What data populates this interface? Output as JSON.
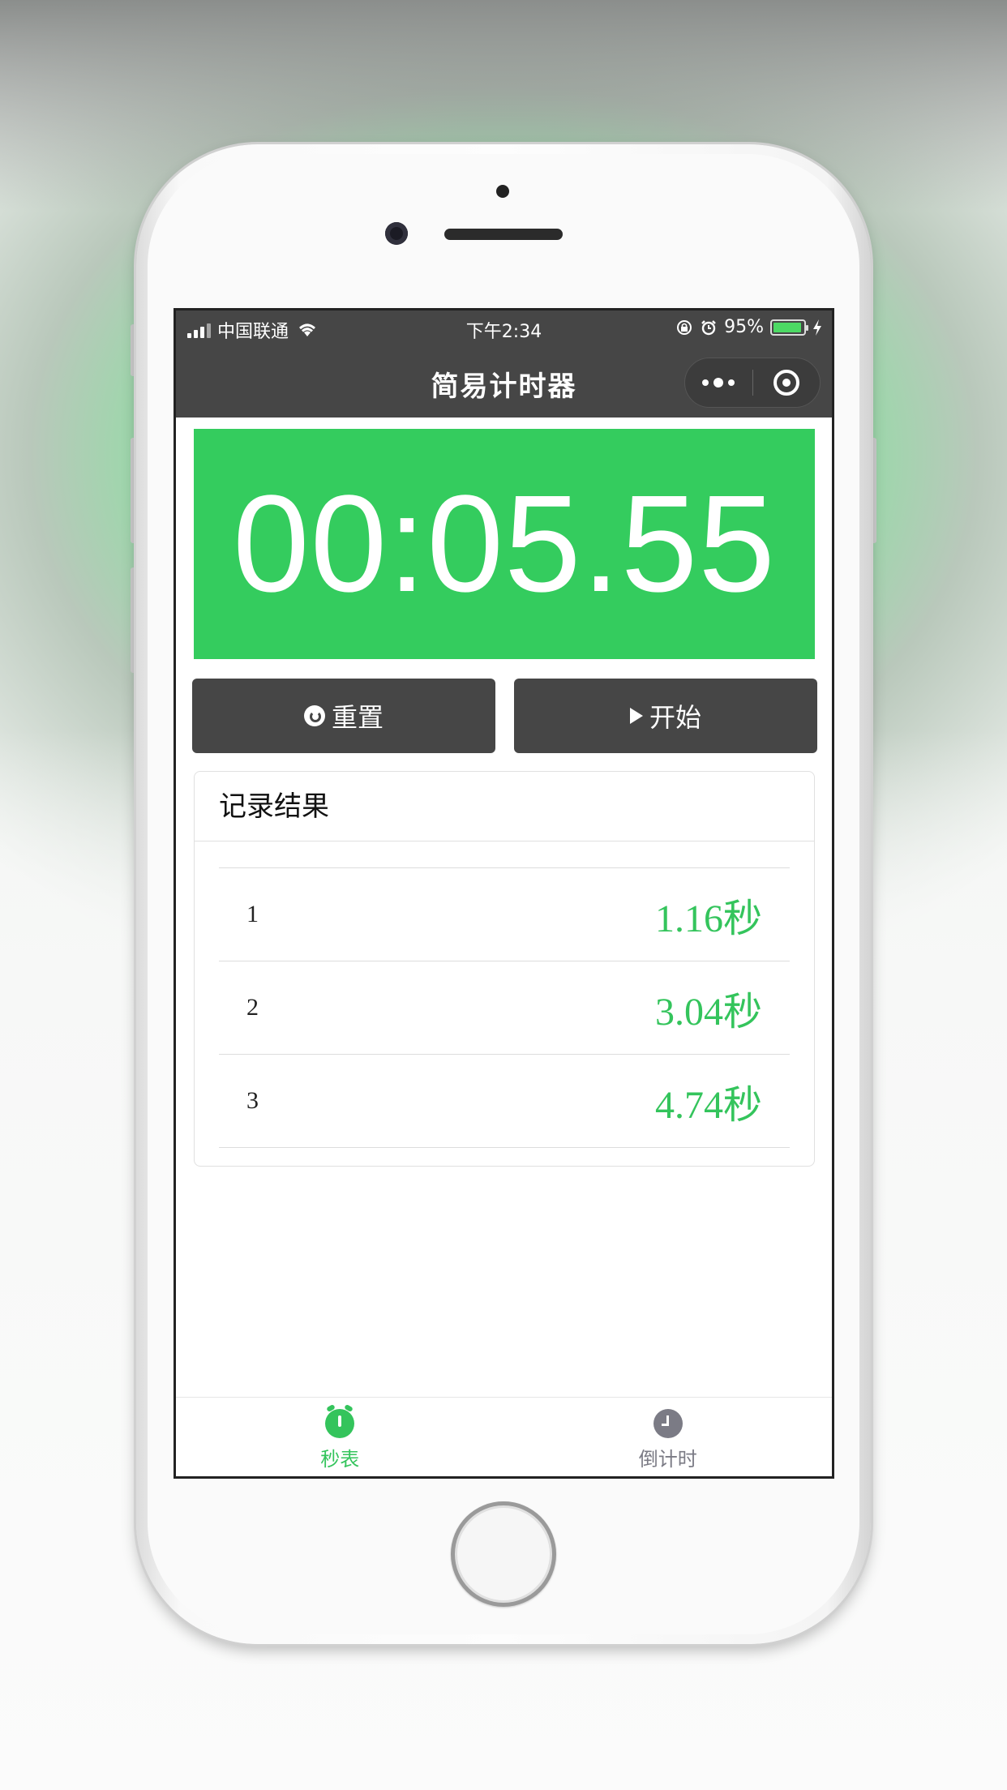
{
  "status_bar": {
    "carrier": "中国联通",
    "time": "下午2:34",
    "battery_percent": "95%",
    "battery_level": 0.95
  },
  "nav": {
    "title": "简易计时器"
  },
  "timer": {
    "display": "00:05.55"
  },
  "buttons": {
    "reset_label": "重置",
    "start_label": "开始"
  },
  "records": {
    "title": "记录结果",
    "items": [
      {
        "index": "1",
        "time": "1.16秒"
      },
      {
        "index": "2",
        "time": "3.04秒"
      },
      {
        "index": "3",
        "time": "4.74秒"
      }
    ]
  },
  "tabs": [
    {
      "label": "秒表",
      "icon": "stopwatch-icon",
      "active": true
    },
    {
      "label": "倒计时",
      "icon": "clock-icon",
      "active": false
    }
  ],
  "colors": {
    "accent": "#34cc5e",
    "nav_bg": "#464646",
    "inactive_tab": "#7b7b85"
  }
}
